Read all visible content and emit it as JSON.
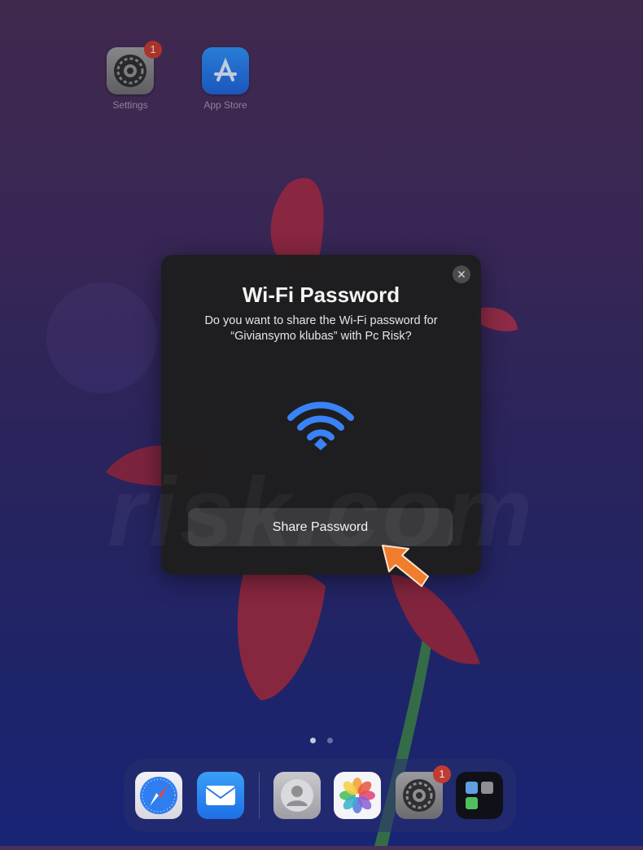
{
  "home_screen": {
    "apps": [
      {
        "name": "Settings",
        "badge": "1",
        "icon": "gear-icon"
      },
      {
        "name": "App Store",
        "icon": "app-store-icon"
      }
    ]
  },
  "dialog": {
    "title": "Wi-Fi Password",
    "message": "Do you want to share the Wi-Fi password for “Giviansymo klubas” with Pc Risk?",
    "close_glyph": "✕",
    "icon": "wifi-icon",
    "share_button": "Share Password"
  },
  "watermark": "risk.com",
  "page_indicator": {
    "count": 2,
    "active": 0
  },
  "dock": {
    "apps": [
      {
        "name": "Safari",
        "icon": "compass-icon"
      },
      {
        "name": "Mail",
        "icon": "envelope-icon"
      },
      {
        "name": "Contacts",
        "icon": "person-icon"
      },
      {
        "name": "Photos",
        "icon": "flower-icon"
      },
      {
        "name": "Settings",
        "icon": "gear-icon",
        "badge": "1"
      },
      {
        "name": "Utilities",
        "icon": "folder-icon"
      }
    ]
  },
  "colors": {
    "wifi_blue": "#3a82f7",
    "badge_red": "#c23b32",
    "arrow_orange": "#ef7d2c"
  }
}
